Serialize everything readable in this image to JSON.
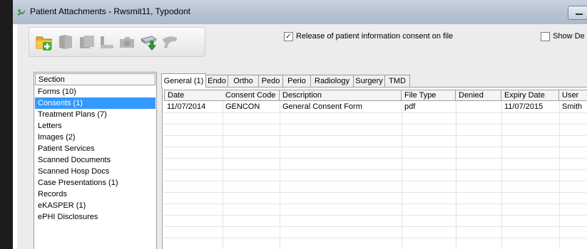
{
  "window": {
    "title": "Patient Attachments - Rwsmit11, Typodont"
  },
  "colors": {
    "selection": "#3399ff",
    "titlebar": "#b6c3d3",
    "background": "#ececec"
  },
  "toolbar": {
    "icons": [
      "add-folder-icon",
      "document-icon",
      "documents-icon",
      "chart-icon",
      "camera-icon",
      "scanner-icon",
      "tooth-icon"
    ]
  },
  "options": {
    "consent_checked": true,
    "consent_label": "Release of patient information consent on file",
    "show_checked": false,
    "show_label": "Show De"
  },
  "sections": {
    "header": "Section",
    "items": [
      "Forms (10)",
      "Consents (1)",
      "Treatment Plans (7)",
      "Letters",
      "Images (2)",
      "Patient Services",
      "Scanned Documents",
      "Scanned Hosp Docs",
      "Case Presentations (1)",
      "Records",
      "eKASPER (1)",
      "ePHI Disclosures"
    ],
    "selected_index": 1
  },
  "tabs": [
    "General (1)",
    "Endo",
    "Ortho",
    "Pedo",
    "Perio",
    "Radiology",
    "Surgery",
    "TMD"
  ],
  "active_tab": 0,
  "grid": {
    "columns": [
      "Date",
      "Consent Code",
      "Description",
      "File Type",
      "Denied",
      "Expiry Date",
      "User"
    ],
    "rows": [
      [
        "11/07/2014",
        "GENCON",
        "General Consent Form",
        "pdf",
        "",
        "11/07/2015",
        "Smith"
      ]
    ]
  }
}
